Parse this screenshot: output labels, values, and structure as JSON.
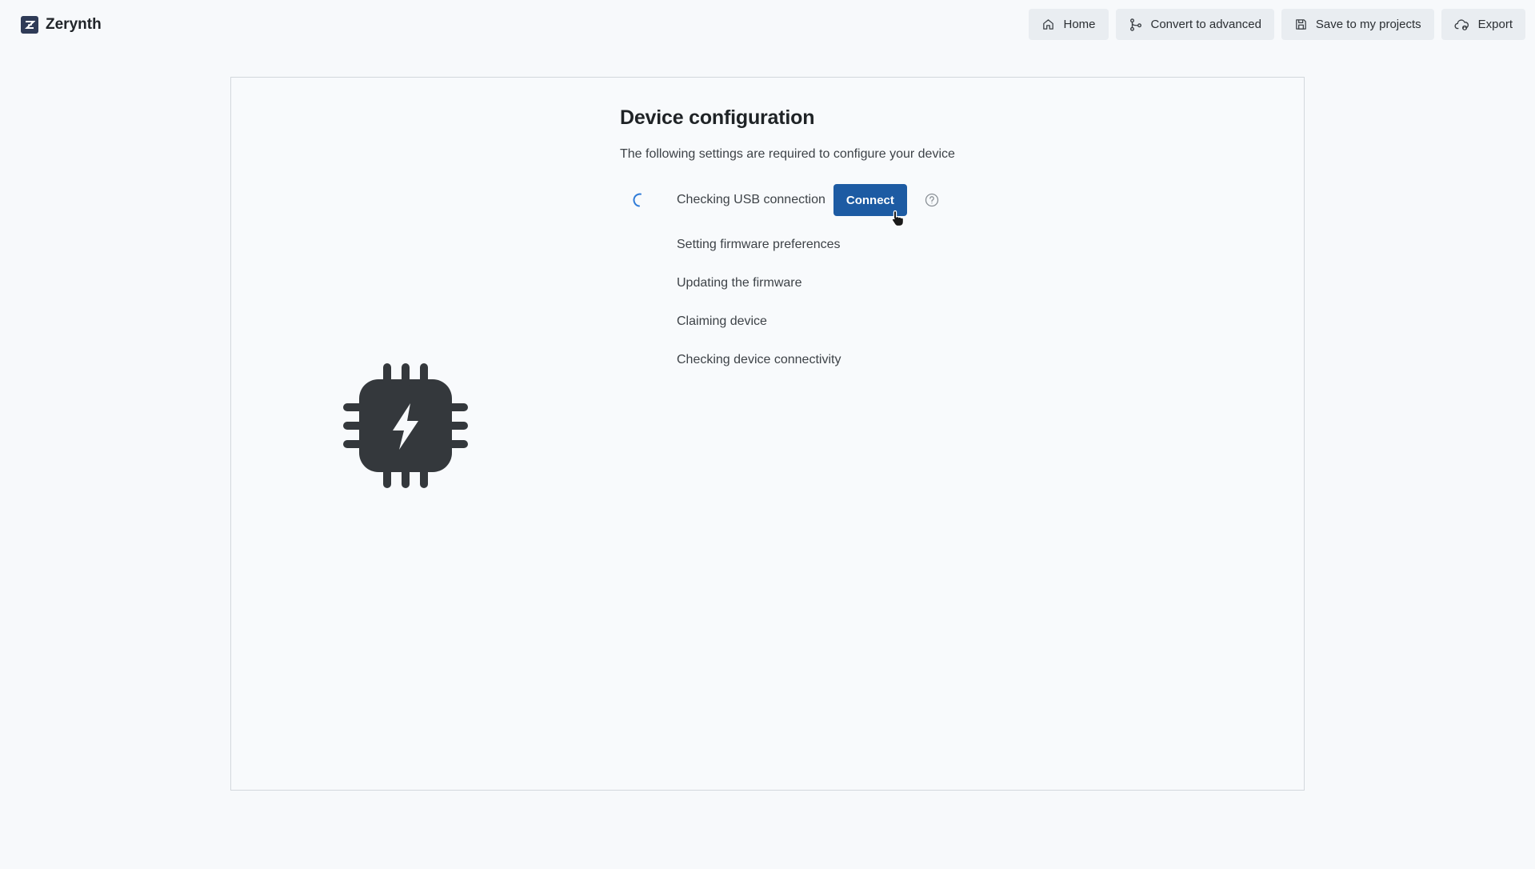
{
  "app": {
    "name": "Zerynth"
  },
  "nav": {
    "home": "Home",
    "convert": "Convert to advanced",
    "save": "Save to my projects",
    "export": "Export"
  },
  "config": {
    "title": "Device configuration",
    "subtitle": "The following settings are required to configure your device",
    "connect_label": "Connect",
    "steps": [
      {
        "label": "Checking USB connection",
        "status": "in-progress"
      },
      {
        "label": "Setting firmware preferences",
        "status": "pending"
      },
      {
        "label": "Updating the firmware",
        "status": "pending"
      },
      {
        "label": "Claiming device",
        "status": "pending"
      },
      {
        "label": "Checking device connectivity",
        "status": "pending"
      }
    ]
  },
  "icons": {
    "brand": "zerynth-logo-icon",
    "home": "home-icon",
    "convert": "branch-icon",
    "save": "floppy-disk-icon",
    "export": "cloud-export-icon",
    "help": "question-circle-icon",
    "device": "chip-lightning-icon",
    "spinner": "loading-spinner-icon"
  },
  "colors": {
    "primary": "#1d5ba3",
    "chip": "#34383c",
    "spinner": "#2f7bd8"
  }
}
